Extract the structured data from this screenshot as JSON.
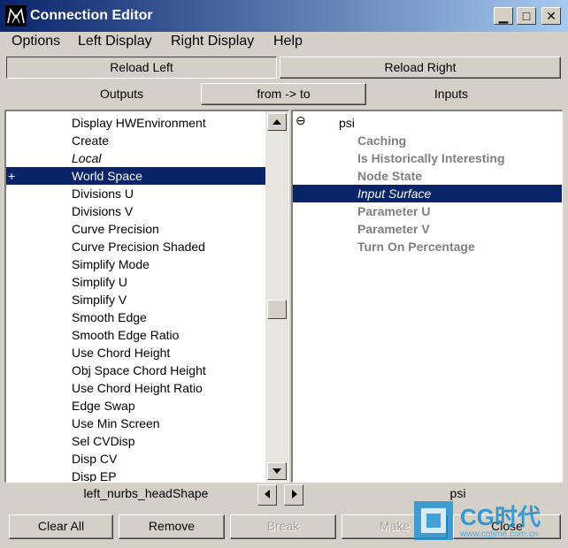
{
  "window": {
    "title": "Connection Editor"
  },
  "menu": [
    "Options",
    "Left Display",
    "Right Display",
    "Help"
  ],
  "reload": {
    "left": "Reload Left",
    "right": "Reload Right"
  },
  "columns": {
    "outputs": "Outputs",
    "direction": "from -> to",
    "inputs": "Inputs"
  },
  "left_list": {
    "items": [
      {
        "label": "Display HWEnvironment"
      },
      {
        "label": "Create"
      },
      {
        "label": "Local",
        "italic": true
      },
      {
        "label": "World Space",
        "selected": true,
        "marker": "+"
      },
      {
        "label": "Divisions U"
      },
      {
        "label": "Divisions V"
      },
      {
        "label": "Curve Precision"
      },
      {
        "label": "Curve Precision Shaded"
      },
      {
        "label": "Simplify Mode"
      },
      {
        "label": "Simplify U"
      },
      {
        "label": "Simplify V"
      },
      {
        "label": "Smooth Edge"
      },
      {
        "label": "Smooth Edge Ratio"
      },
      {
        "label": "Use Chord Height"
      },
      {
        "label": "Obj Space Chord Height"
      },
      {
        "label": "Use Chord Height Ratio"
      },
      {
        "label": "Edge Swap"
      },
      {
        "label": "Use Min Screen"
      },
      {
        "label": "Sel CVDisp"
      },
      {
        "label": "Disp CV"
      },
      {
        "label": "Disp EP"
      }
    ]
  },
  "right_list": {
    "root": {
      "label": "psi",
      "expander": "⊖"
    },
    "items": [
      {
        "label": "Caching"
      },
      {
        "label": "Is Historically Interesting"
      },
      {
        "label": "Node State"
      },
      {
        "label": "Input Surface",
        "selected": true,
        "italic": true
      },
      {
        "label": "Parameter U"
      },
      {
        "label": "Parameter V"
      },
      {
        "label": "Turn On Percentage"
      }
    ]
  },
  "status": {
    "left_node": "left_nurbs_headShape",
    "right_node": "psi"
  },
  "buttons": {
    "clear_all": "Clear All",
    "remove": "Remove",
    "break": "Break",
    "make": "Make",
    "close": "Close"
  },
  "watermark": {
    "brand": "CG时代",
    "url": "www.cgtime.com.cn"
  },
  "colors": {
    "selection": "#0a246a",
    "face": "#d4d0c8",
    "disabled": "#808080"
  }
}
